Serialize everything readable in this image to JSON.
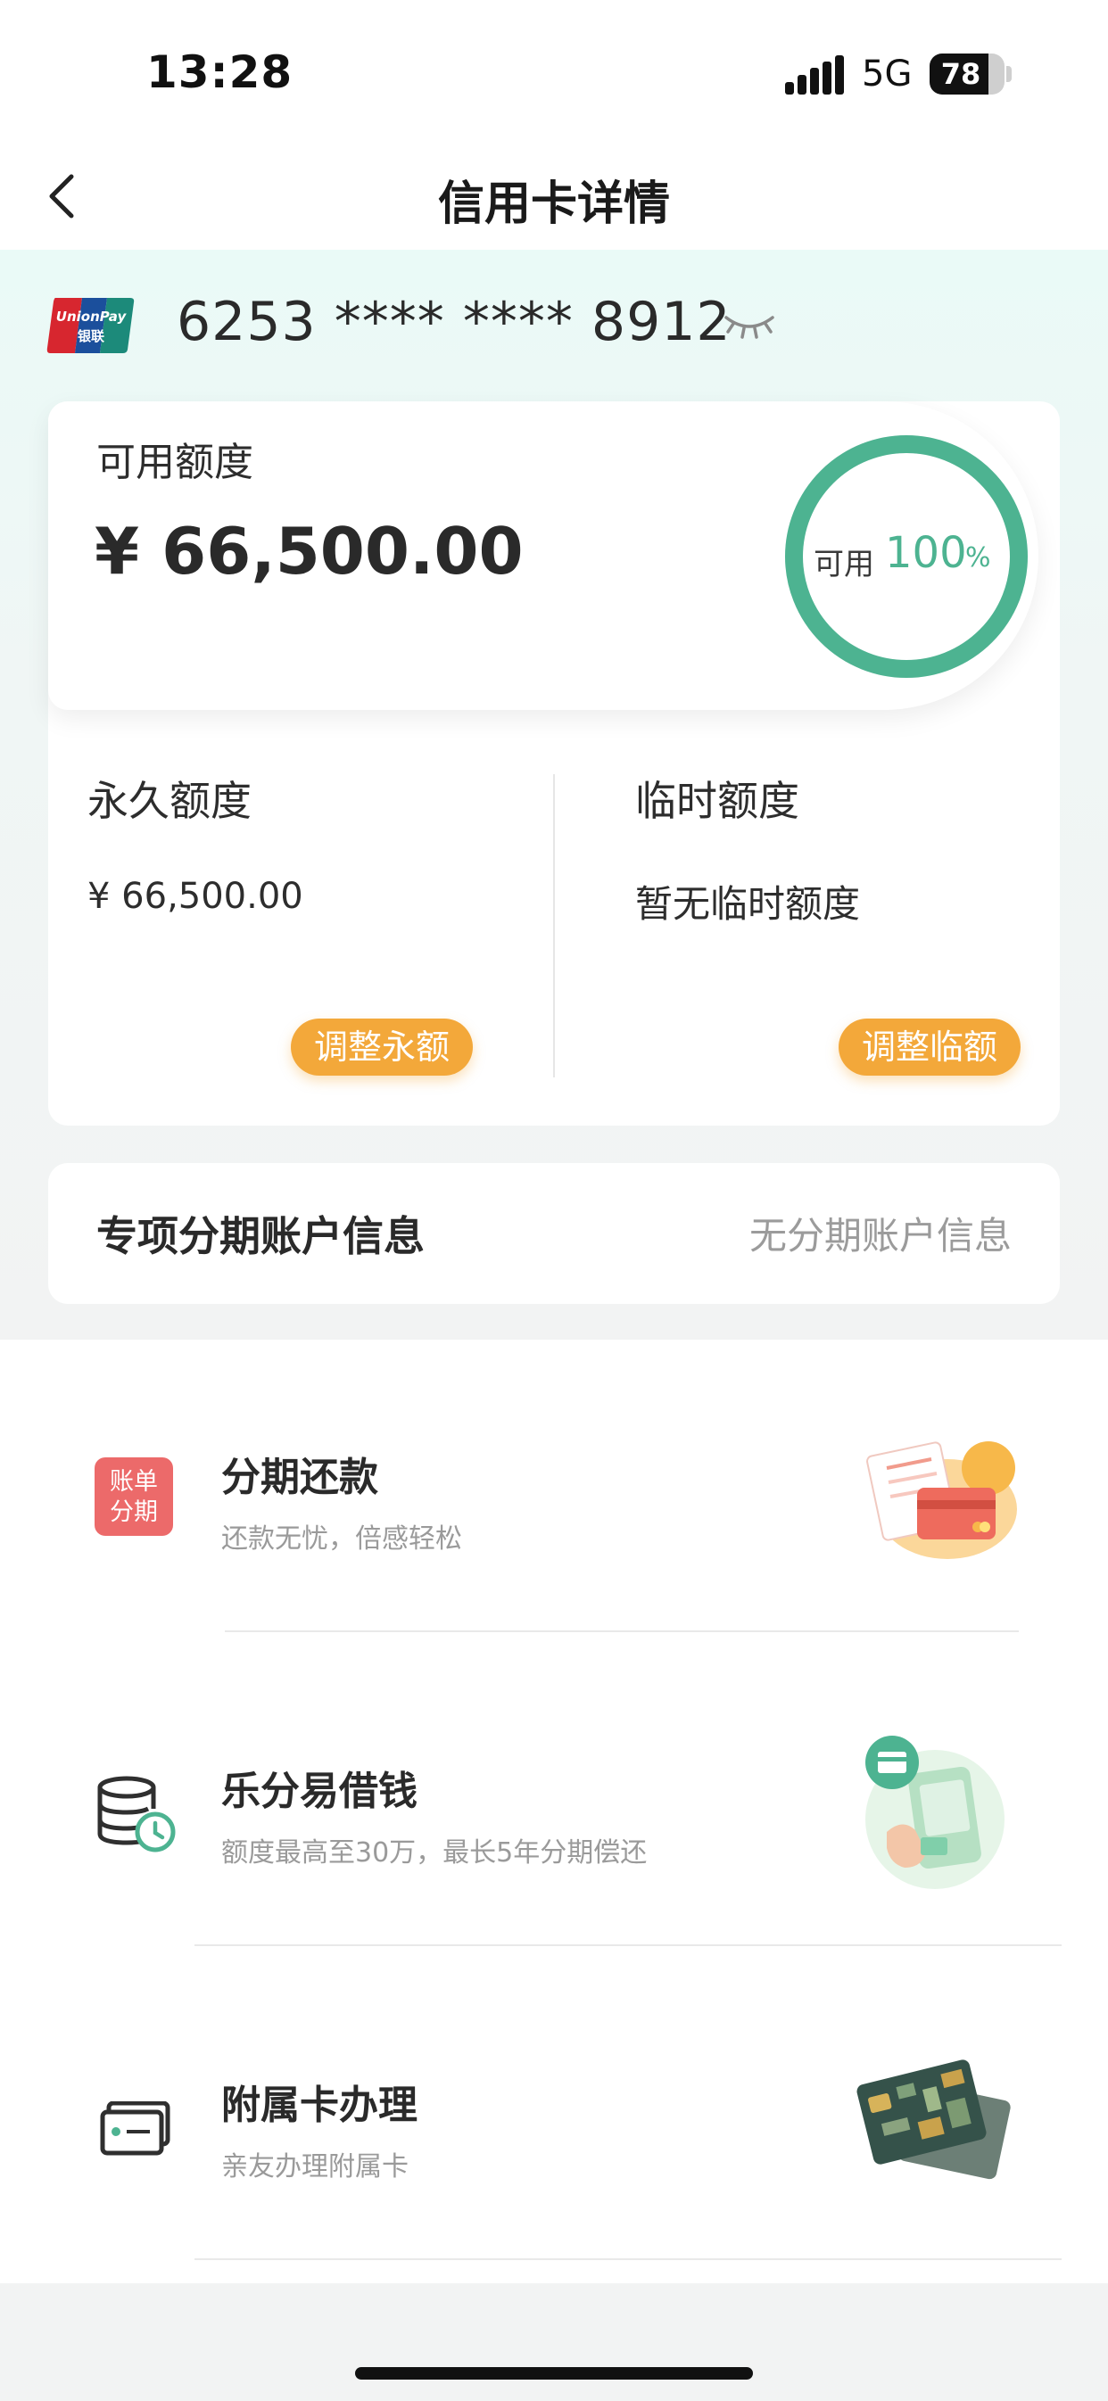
{
  "status_bar": {
    "time": "13:28",
    "network": "5G",
    "battery": "78",
    "battery_level": 0.78
  },
  "nav": {
    "title": "信用卡详情"
  },
  "card": {
    "number": "6253 **** **** 8912",
    "brand_logo_text": "UnionPay 银联"
  },
  "available": {
    "title": "可用额度",
    "amount": "¥ 66,500.00",
    "ring_label": "可用",
    "ring_percent": "100",
    "ring_unit": "%",
    "ring_fraction": 1.0
  },
  "permanent": {
    "title": "永久额度",
    "amount": "¥ 66,500.00",
    "button": "调整永额"
  },
  "temporary": {
    "title": "临时额度",
    "amount": "暂无临时额度",
    "button": "调整临额"
  },
  "installment_account": {
    "label": "专项分期账户信息",
    "value": "无分期账户信息"
  },
  "services": [
    {
      "title": "分期还款",
      "subtitle": "还款无忧，倍感轻松",
      "icon": "bill-installment-icon",
      "icon_text": [
        "账单",
        "分期"
      ]
    },
    {
      "title": "乐分易借钱",
      "subtitle": "额度最高至30万，最长5年分期偿还",
      "icon": "coins-clock-icon"
    },
    {
      "title": "附属卡办理",
      "subtitle": "亲友办理附属卡",
      "icon": "card-icon"
    }
  ],
  "colors": {
    "accent_green": "#4db391",
    "button_orange": "#f3a83a",
    "bill_icon_red": "#ec6a6a"
  }
}
